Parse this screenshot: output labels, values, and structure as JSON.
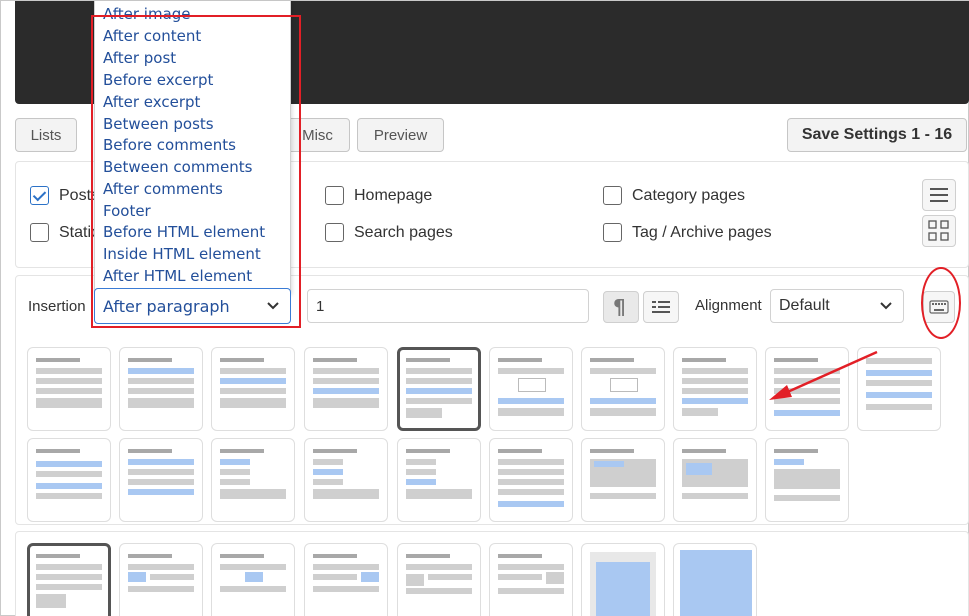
{
  "tabs": {
    "lists": "Lists",
    "misc": "Misc",
    "preview": "Preview",
    "save": "Save Settings 1 - 16"
  },
  "pages": {
    "posts": "Posts",
    "static": "Static pages",
    "homepage": "Homepage",
    "search": "Search pages",
    "category": "Category pages",
    "tag_archive": "Tag / Archive pages"
  },
  "insertion": {
    "label": "Insertion",
    "selected": "After paragraph",
    "paragraph_number": "1",
    "alignment_label": "Alignment",
    "alignment_value": "Default"
  },
  "insertion_options": [
    "After image",
    "After content",
    "After post",
    "Before excerpt",
    "After excerpt",
    "Between posts",
    "Before comments",
    "Between comments",
    "After comments",
    "Footer",
    "Before HTML element",
    "Inside HTML element",
    "After HTML element"
  ],
  "colors": {
    "annotation": "#e21f26",
    "focus": "#3a7bd5",
    "link": "#234f9a",
    "thumb_blue": "#a9c8f2"
  },
  "icons": {
    "list_view": "hamburger-icon",
    "grid_view": "grid-icon",
    "paragraph": "pilcrow-icon",
    "content": "text-lines-icon",
    "keyboard": "keyboard-icon"
  }
}
